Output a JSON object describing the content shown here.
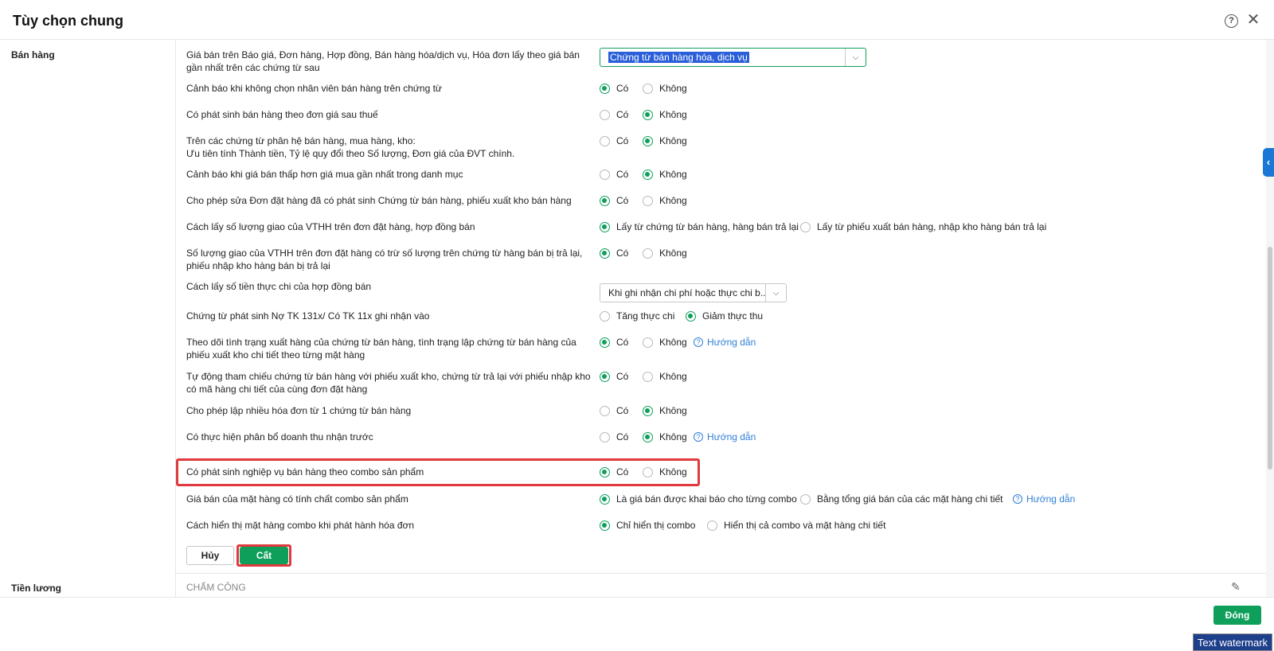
{
  "dialog": {
    "title": "Tùy chọn chung",
    "close_label": "✕",
    "help_label": "?"
  },
  "sections": {
    "ban_hang": "Bán hàng",
    "tien_luong": "Tiền lương"
  },
  "rows": [
    {
      "label": "Giá bán trên Báo giá, Đơn hàng, Hợp đồng, Bán hàng hóa/dịch vụ, Hóa đơn lấy theo giá bán gần nhất trên các chứng từ sau",
      "type": "select",
      "value": "Chứng từ bán hàng hóa, dịch vụ"
    },
    {
      "label": "Cảnh báo khi không chọn nhân viên bán hàng trên chứng từ",
      "options": [
        "Có",
        "Không"
      ],
      "selected": "Có"
    },
    {
      "label": "Có phát sinh bán hàng theo đơn giá sau thuế",
      "options": [
        "Có",
        "Không"
      ],
      "selected": "Không"
    },
    {
      "label": "Trên các chứng từ phân hệ bán hàng, mua hàng, kho:",
      "label2": "Ưu tiên tính Thành tiền, Tỷ lệ quy đổi theo Số lượng, Đơn giá của ĐVT chính.",
      "options": [
        "Có",
        "Không"
      ],
      "selected": "Không"
    },
    {
      "label": "Cảnh báo khi giá bán thấp hơn giá mua gần nhất trong danh mục",
      "options": [
        "Có",
        "Không"
      ],
      "selected": "Không"
    },
    {
      "label": "Cho phép sửa Đơn đặt hàng đã có phát sinh Chứng từ bán hàng, phiếu xuất kho bán hàng",
      "options": [
        "Có",
        "Không"
      ],
      "selected": "Có"
    },
    {
      "label": "Cách lấy số lượng giao của VTHH trên đơn đặt hàng, hợp đồng bán",
      "options": [
        "Lấy từ chứng từ bán hàng, hàng bán trả lại",
        "Lấy từ phiếu xuất bán hàng, nhập kho hàng bán trả lại"
      ],
      "selected": "Lấy từ chứng từ bán hàng, hàng bán trả lại"
    },
    {
      "label": "Số lượng giao của VTHH trên đơn đặt hàng có trừ số lượng trên chứng từ hàng bán bị trả lại, phiếu nhập kho hàng bán bị trả lại",
      "options": [
        "Có",
        "Không"
      ],
      "selected": "Có"
    },
    {
      "label": "Cách lấy số tiền thực chi của hợp đồng bán",
      "type": "select",
      "value": "Khi ghi nhận chi phí hoặc thực chi b..."
    },
    {
      "label": "Chứng từ phát sinh Nợ TK 131x/ Có TK 11x ghi nhận vào",
      "options": [
        "Tăng thực chi",
        "Giảm thực thu"
      ],
      "selected": "Giảm thực thu"
    },
    {
      "label": "Theo dõi tình trạng xuất hàng của chứng từ bán hàng, tình trạng lập chứng từ bán hàng của phiếu xuất kho chi tiết theo từng mặt hàng",
      "options": [
        "Có",
        "Không"
      ],
      "selected": "Có",
      "guide": "Hướng dẫn"
    },
    {
      "label": "Tự động tham chiếu chứng từ bán hàng với phiếu xuất kho, chứng từ trả lại với phiếu nhập kho có mã hàng chi tiết của cùng đơn đặt hàng",
      "options": [
        "Có",
        "Không"
      ],
      "selected": "Có"
    },
    {
      "label": "Cho phép lập nhiều hóa đơn từ 1 chứng từ bán hàng",
      "options": [
        "Có",
        "Không"
      ],
      "selected": "Không"
    },
    {
      "label": "Có thực hiện phân bổ doanh thu nhận trước",
      "options": [
        "Có",
        "Không"
      ],
      "selected": "Không",
      "guide": "Hướng dẫn"
    },
    {
      "label": "Có phát sinh nghiệp vụ bán hàng theo combo sản phẩm",
      "options": [
        "Có",
        "Không"
      ],
      "selected": "Có"
    },
    {
      "label": "Giá bán của mặt hàng có tính chất combo sản phẩm",
      "options": [
        "Là giá bán được khai báo cho từng combo",
        "Bằng tổng giá bán của các mặt hàng chi tiết"
      ],
      "selected": "Là giá bán được khai báo cho từng combo",
      "guide": "Hướng dẫn"
    },
    {
      "label": "Cách hiển thị mặt hàng combo khi phát hành hóa đơn",
      "options": [
        "Chỉ hiển thị combo",
        "Hiển thị cả combo và mặt hàng chi tiết"
      ],
      "selected": "Chỉ hiển thị combo"
    }
  ],
  "buttons": {
    "cancel": "Hủy",
    "save": "Cất",
    "close": "Đóng"
  },
  "tien_luong_sub": "CHẤM CÔNG",
  "side_tab_glyph": "‹",
  "watermark": "Text watermark",
  "colors": {
    "accent": "#0e9f5b",
    "highlight_box": "#e0393e",
    "link": "#2f7fd6"
  }
}
